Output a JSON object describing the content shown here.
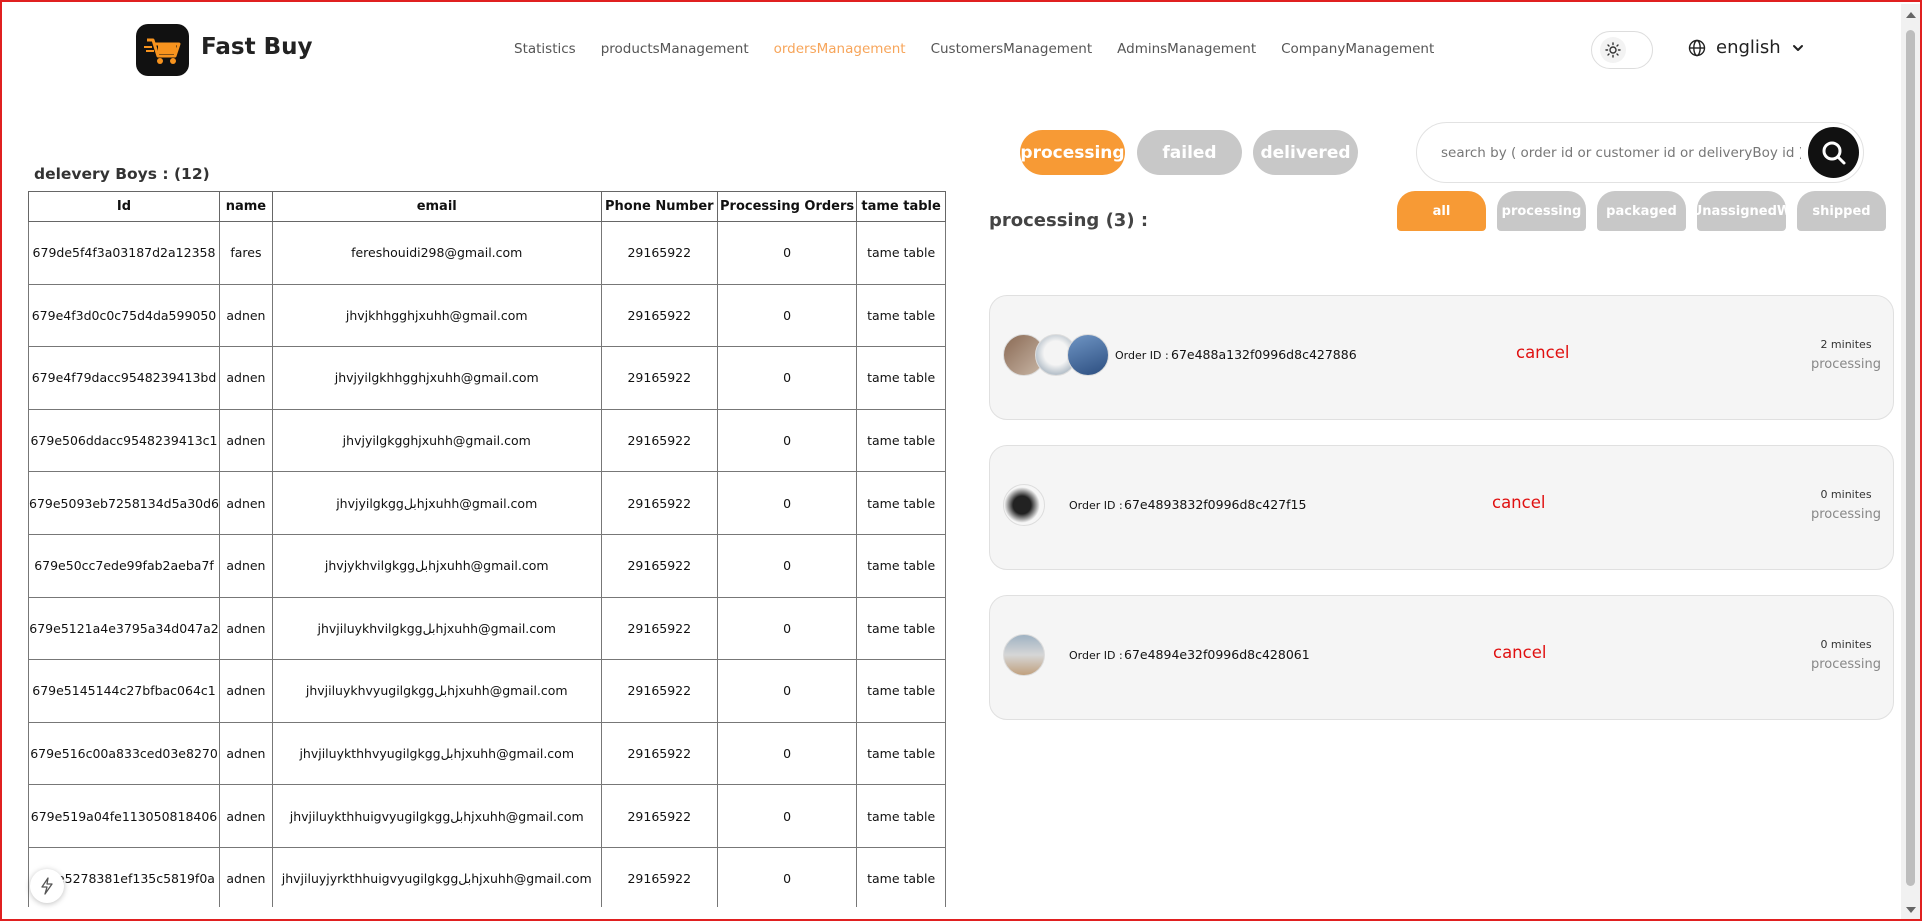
{
  "header": {
    "brand": "Fast Buy",
    "nav": [
      {
        "label": "Statistics",
        "active": false
      },
      {
        "label": "productsManagement",
        "active": false
      },
      {
        "label": "ordersManagement",
        "active": true
      },
      {
        "label": "CustomersManagement",
        "active": false
      },
      {
        "label": "AdminsManagement",
        "active": false
      },
      {
        "label": "CompanyManagement",
        "active": false
      }
    ],
    "language": "english",
    "accent_color": "#f7a55a"
  },
  "delivery": {
    "title": "delevery Boys : (12)",
    "columns": [
      "Id",
      "name",
      "email",
      "Phone Number",
      "Processing Orders",
      "tame table"
    ],
    "rows": [
      {
        "id": "679de5f4f3a03187d2a12358",
        "name": "fares",
        "email": "fereshouidi298@gmail.com",
        "phone": "29165922",
        "processing": "0",
        "timetable": "tame table"
      },
      {
        "id": "679e4f3d0c0c75d4da599050",
        "name": "adnen",
        "email": "jhvjkhhgghjxuhh@gmail.com",
        "phone": "29165922",
        "processing": "0",
        "timetable": "tame table"
      },
      {
        "id": "679e4f79dacc9548239413bd",
        "name": "adnen",
        "email": "jhvjyilgkhhgghjxuhh@gmail.com",
        "phone": "29165922",
        "processing": "0",
        "timetable": "tame table"
      },
      {
        "id": "679e506ddacc9548239413c1",
        "name": "adnen",
        "email": "jhvjyilgkgghjxuhh@gmail.com",
        "phone": "29165922",
        "processing": "0",
        "timetable": "tame table"
      },
      {
        "id": "679e5093eb7258134d5a30d6",
        "name": "adnen",
        "email": "jhvjyilgkggبلhjxuhh@gmail.com",
        "phone": "29165922",
        "processing": "0",
        "timetable": "tame table"
      },
      {
        "id": "679e50cc7ede99fab2aeba7f",
        "name": "adnen",
        "email": "jhvjykhvilgkggبلhjxuhh@gmail.com",
        "phone": "29165922",
        "processing": "0",
        "timetable": "tame table"
      },
      {
        "id": "679e5121a4e3795a34d047a2",
        "name": "adnen",
        "email": "jhvjiluykhvilgkggبلhjxuhh@gmail.com",
        "phone": "29165922",
        "processing": "0",
        "timetable": "tame table"
      },
      {
        "id": "679e5145144c27bfbac064c1",
        "name": "adnen",
        "email": "jhvjiluykhvyugilgkggبلhjxuhh@gmail.com",
        "phone": "29165922",
        "processing": "0",
        "timetable": "tame table"
      },
      {
        "id": "679e516c00a833ced03e8270",
        "name": "adnen",
        "email": "jhvjiluykthhvyugilgkggبلhjxuhh@gmail.com",
        "phone": "29165922",
        "processing": "0",
        "timetable": "tame table"
      },
      {
        "id": "679e519a04fe113050818406",
        "name": "adnen",
        "email": "jhvjiluykthhuigvyugilgkggبلhjxuhh@gmail.com",
        "phone": "29165922",
        "processing": "0",
        "timetable": "tame table"
      },
      {
        "id": "679e5278381ef135c5819f0a",
        "name": "adnen",
        "email": "jhvjiluyjyrkthhuigvyugilgkggبلhjxuhh@gmail.com",
        "phone": "29165922",
        "processing": "0",
        "timetable": "tame table"
      }
    ]
  },
  "orders": {
    "status_tabs": [
      "processing",
      "failed",
      "delivered"
    ],
    "search_placeholder": "search by ( order id or customer id or deliveryBoy id ) ...",
    "section_title": "processing (3) :",
    "sub_tabs": [
      "all",
      "processing",
      "packaged",
      "UnassignedW",
      "shipped"
    ],
    "list": [
      {
        "label": "Order ID :",
        "id": "67e488a132f0996d8c427886",
        "cancel": "cancel",
        "time": "2 minites",
        "status": "processing",
        "thumbs": [
          "tshirt-thumb",
          "dog-thumb",
          "jacket-thumb"
        ]
      },
      {
        "label": "Order ID :",
        "id": "67e4893832f0996d8c427f15",
        "cancel": "cancel",
        "time": "0 minites",
        "status": "processing",
        "thumbs": [
          "heels-thumb"
        ]
      },
      {
        "label": "Order ID :",
        "id": "67e4894e32f0996d8c428061",
        "cancel": "cancel",
        "time": "0 minites",
        "status": "processing",
        "thumbs": [
          "product-thumb"
        ]
      }
    ]
  }
}
